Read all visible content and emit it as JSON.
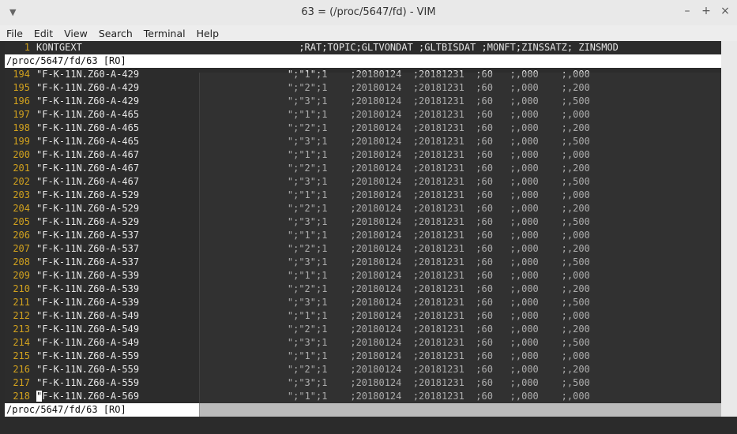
{
  "window": {
    "title": "63 = (/proc/5647/fd) - VIM",
    "menu_icon": "▼",
    "controls": {
      "minimize": "–",
      "maximize": "+",
      "close": "×"
    }
  },
  "menu": [
    "File",
    "Edit",
    "View",
    "Search",
    "Terminal",
    "Help"
  ],
  "top_window": {
    "line_number": "1",
    "header_text": "KONTGEXT                                      ;RAT;TOPIC;GLTVONDAT ;GLTBISDAT ;MONFT;ZINSSATZ; ZINSMOD",
    "status": "/proc/5647/fd/63 [RO]"
  },
  "rows": [
    {
      "n": "194",
      "t": "\"F-K-11N.Z60-A-429                          \";\"1\";1    ;20180124  ;20181231  ;60   ;,000    ;,000"
    },
    {
      "n": "195",
      "t": "\"F-K-11N.Z60-A-429                          \";\"2\";1    ;20180124  ;20181231  ;60   ;,000    ;,200"
    },
    {
      "n": "196",
      "t": "\"F-K-11N.Z60-A-429                          \";\"3\";1    ;20180124  ;20181231  ;60   ;,000    ;,500"
    },
    {
      "n": "197",
      "t": "\"F-K-11N.Z60-A-465                          \";\"1\";1    ;20180124  ;20181231  ;60   ;,000    ;,000"
    },
    {
      "n": "198",
      "t": "\"F-K-11N.Z60-A-465                          \";\"2\";1    ;20180124  ;20181231  ;60   ;,000    ;,200"
    },
    {
      "n": "199",
      "t": "\"F-K-11N.Z60-A-465                          \";\"3\";1    ;20180124  ;20181231  ;60   ;,000    ;,500"
    },
    {
      "n": "200",
      "t": "\"F-K-11N.Z60-A-467                          \";\"1\";1    ;20180124  ;20181231  ;60   ;,000    ;,000"
    },
    {
      "n": "201",
      "t": "\"F-K-11N.Z60-A-467                          \";\"2\";1    ;20180124  ;20181231  ;60   ;,000    ;,200"
    },
    {
      "n": "202",
      "t": "\"F-K-11N.Z60-A-467                          \";\"3\";1    ;20180124  ;20181231  ;60   ;,000    ;,500"
    },
    {
      "n": "203",
      "t": "\"F-K-11N.Z60-A-529                          \";\"1\";1    ;20180124  ;20181231  ;60   ;,000    ;,000"
    },
    {
      "n": "204",
      "t": "\"F-K-11N.Z60-A-529                          \";\"2\";1    ;20180124  ;20181231  ;60   ;,000    ;,200"
    },
    {
      "n": "205",
      "t": "\"F-K-11N.Z60-A-529                          \";\"3\";1    ;20180124  ;20181231  ;60   ;,000    ;,500"
    },
    {
      "n": "206",
      "t": "\"F-K-11N.Z60-A-537                          \";\"1\";1    ;20180124  ;20181231  ;60   ;,000    ;,000"
    },
    {
      "n": "207",
      "t": "\"F-K-11N.Z60-A-537                          \";\"2\";1    ;20180124  ;20181231  ;60   ;,000    ;,200"
    },
    {
      "n": "208",
      "t": "\"F-K-11N.Z60-A-537                          \";\"3\";1    ;20180124  ;20181231  ;60   ;,000    ;,500"
    },
    {
      "n": "209",
      "t": "\"F-K-11N.Z60-A-539                          \";\"1\";1    ;20180124  ;20181231  ;60   ;,000    ;,000"
    },
    {
      "n": "210",
      "t": "\"F-K-11N.Z60-A-539                          \";\"2\";1    ;20180124  ;20181231  ;60   ;,000    ;,200"
    },
    {
      "n": "211",
      "t": "\"F-K-11N.Z60-A-539                          \";\"3\";1    ;20180124  ;20181231  ;60   ;,000    ;,500"
    },
    {
      "n": "212",
      "t": "\"F-K-11N.Z60-A-549                          \";\"1\";1    ;20180124  ;20181231  ;60   ;,000    ;,000"
    },
    {
      "n": "213",
      "t": "\"F-K-11N.Z60-A-549                          \";\"2\";1    ;20180124  ;20181231  ;60   ;,000    ;,200"
    },
    {
      "n": "214",
      "t": "\"F-K-11N.Z60-A-549                          \";\"3\";1    ;20180124  ;20181231  ;60   ;,000    ;,500"
    },
    {
      "n": "215",
      "t": "\"F-K-11N.Z60-A-559                          \";\"1\";1    ;20180124  ;20181231  ;60   ;,000    ;,000"
    },
    {
      "n": "216",
      "t": "\"F-K-11N.Z60-A-559                          \";\"2\";1    ;20180124  ;20181231  ;60   ;,000    ;,200"
    },
    {
      "n": "217",
      "t": "\"F-K-11N.Z60-A-559                          \";\"3\";1    ;20180124  ;20181231  ;60   ;,000    ;,500"
    }
  ],
  "cursor_row": {
    "n": "218",
    "cursor_char": "\"",
    "rest": "F-K-11N.Z60-A-569                          \";\"1\";1    ;20180124  ;20181231  ;60   ;,000    ;,000"
  },
  "bottom_status": "/proc/5647/fd/63 [RO]"
}
